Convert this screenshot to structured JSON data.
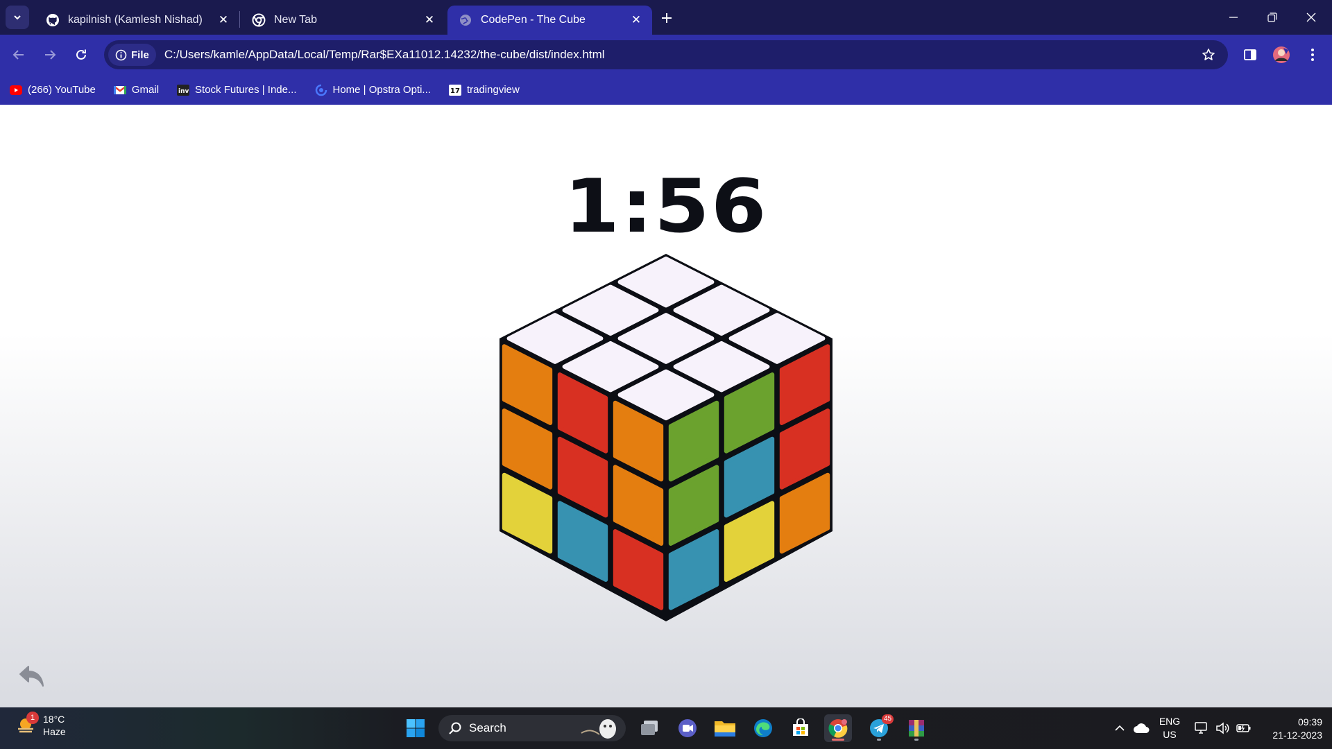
{
  "browser": {
    "tabs": [
      {
        "title": "kapilnish (Kamlesh Nishad)",
        "favicon": "github-icon",
        "active": false
      },
      {
        "title": "New Tab",
        "favicon": "chrome-icon",
        "active": false
      },
      {
        "title": "CodePen - The Cube",
        "favicon": "globe-icon",
        "active": true
      }
    ],
    "address": {
      "chip_label": "File",
      "url": "C:/Users/kamle/AppData/Local/Temp/Rar$EXa11012.14232/the-cube/dist/index.html"
    },
    "bookmarks": [
      {
        "label": "(266) YouTube",
        "icon": "youtube-icon"
      },
      {
        "label": "Gmail",
        "icon": "gmail-icon"
      },
      {
        "label": "Stock Futures | Inde...",
        "icon": "investing-icon"
      },
      {
        "label": "Home | Opstra Opti...",
        "icon": "opstra-icon"
      },
      {
        "label": "tradingview",
        "icon": "tradingview-icon"
      }
    ],
    "colors": {
      "tabstrip": "#1a1a4e",
      "toolbar": "#2f2fa8",
      "omnibox": "#1e1e6a"
    }
  },
  "game": {
    "timer": "1:56",
    "cube": {
      "top": [
        "white",
        "white",
        "white",
        "white",
        "white",
        "white",
        "white",
        "white",
        "white"
      ],
      "left": [
        "orange",
        "red",
        "orange",
        "orange",
        "red",
        "red",
        "yellow",
        "blue",
        "blue"
      ],
      "right": [
        "green",
        "green",
        "red",
        "green",
        "blue",
        "red",
        "green",
        "yellow",
        "orange"
      ],
      "left_grid_note_rows": 3,
      "left_face": [
        [
          "orange",
          "red",
          "orange"
        ],
        [
          "orange",
          "red",
          "orange"
        ],
        [
          "yellow",
          "blue",
          "red"
        ]
      ],
      "right_face": [
        [
          "green",
          "green",
          "red"
        ],
        [
          "green",
          "blue",
          "red"
        ],
        [
          "blue",
          "yellow",
          "orange"
        ]
      ],
      "palette": {
        "white": "#f7f2fb",
        "orange": "#e47e10",
        "red": "#d83022",
        "yellow": "#e3d23a",
        "blue": "#3792b1",
        "green": "#6ba22e"
      }
    }
  },
  "taskbar": {
    "weather": {
      "temp": "18°C",
      "condition": "Haze",
      "badge": "1"
    },
    "search_label": "Search",
    "telegram_badge": "45",
    "tray": {
      "lang_top": "ENG",
      "lang_bottom": "US"
    },
    "clock": {
      "time": "09:39",
      "date": "21-12-2023"
    }
  }
}
